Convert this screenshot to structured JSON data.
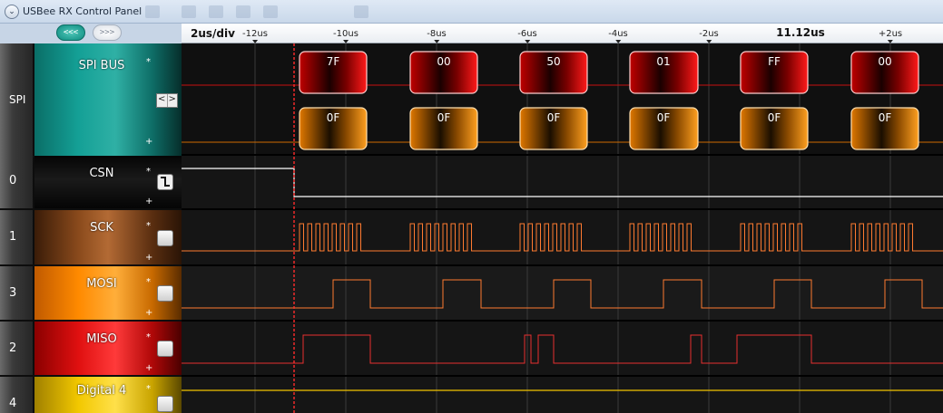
{
  "window": {
    "title": "USBee RX Control Panel"
  },
  "toolbar": {
    "ghost_text": "",
    "nav_left": "<<<",
    "nav_right": ">>>"
  },
  "ruler": {
    "scale": "2us/div",
    "ticks": [
      "-12us",
      "-10us",
      "-8us",
      "-6us",
      "-4us",
      "-2us",
      "+2us"
    ],
    "cursor_label": "11.12us"
  },
  "spi": {
    "label": "SPI",
    "name": "SPI BUS",
    "star": "*",
    "plus": "+",
    "bus_top_bytes": [
      "7F",
      "00",
      "50",
      "01",
      "FF",
      "00"
    ],
    "bus_bottom_bytes": [
      "0F",
      "0F",
      "0F",
      "0F",
      "0F",
      "0F"
    ],
    "scroll_left": "<",
    "scroll_right": ">"
  },
  "channels": [
    {
      "number": "0",
      "name": "CSN",
      "star": "*",
      "plus": "+",
      "color": "#0a0a0a",
      "icon": "edge-icon"
    },
    {
      "number": "1",
      "name": "SCK",
      "star": "*",
      "plus": "+",
      "color": "#8a4a1c",
      "icon": "checkbox"
    },
    {
      "number": "3",
      "name": "MOSI",
      "star": "*",
      "plus": "+",
      "color": "#ff8a00",
      "icon": "checkbox"
    },
    {
      "number": "2",
      "name": "MISO",
      "star": "*",
      "plus": "+",
      "color": "#e01010",
      "icon": "checkbox"
    },
    {
      "number": "4",
      "name": "Digital 4",
      "star": "*",
      "plus": "+",
      "color": "#f2c800",
      "icon": "checkbox"
    }
  ],
  "colors": {
    "accent_teal": "#0e9b90",
    "bus_red": "#c40000",
    "bus_orange": "#e07800",
    "trace": "#ff7a30",
    "cursor": "#ff3030"
  }
}
